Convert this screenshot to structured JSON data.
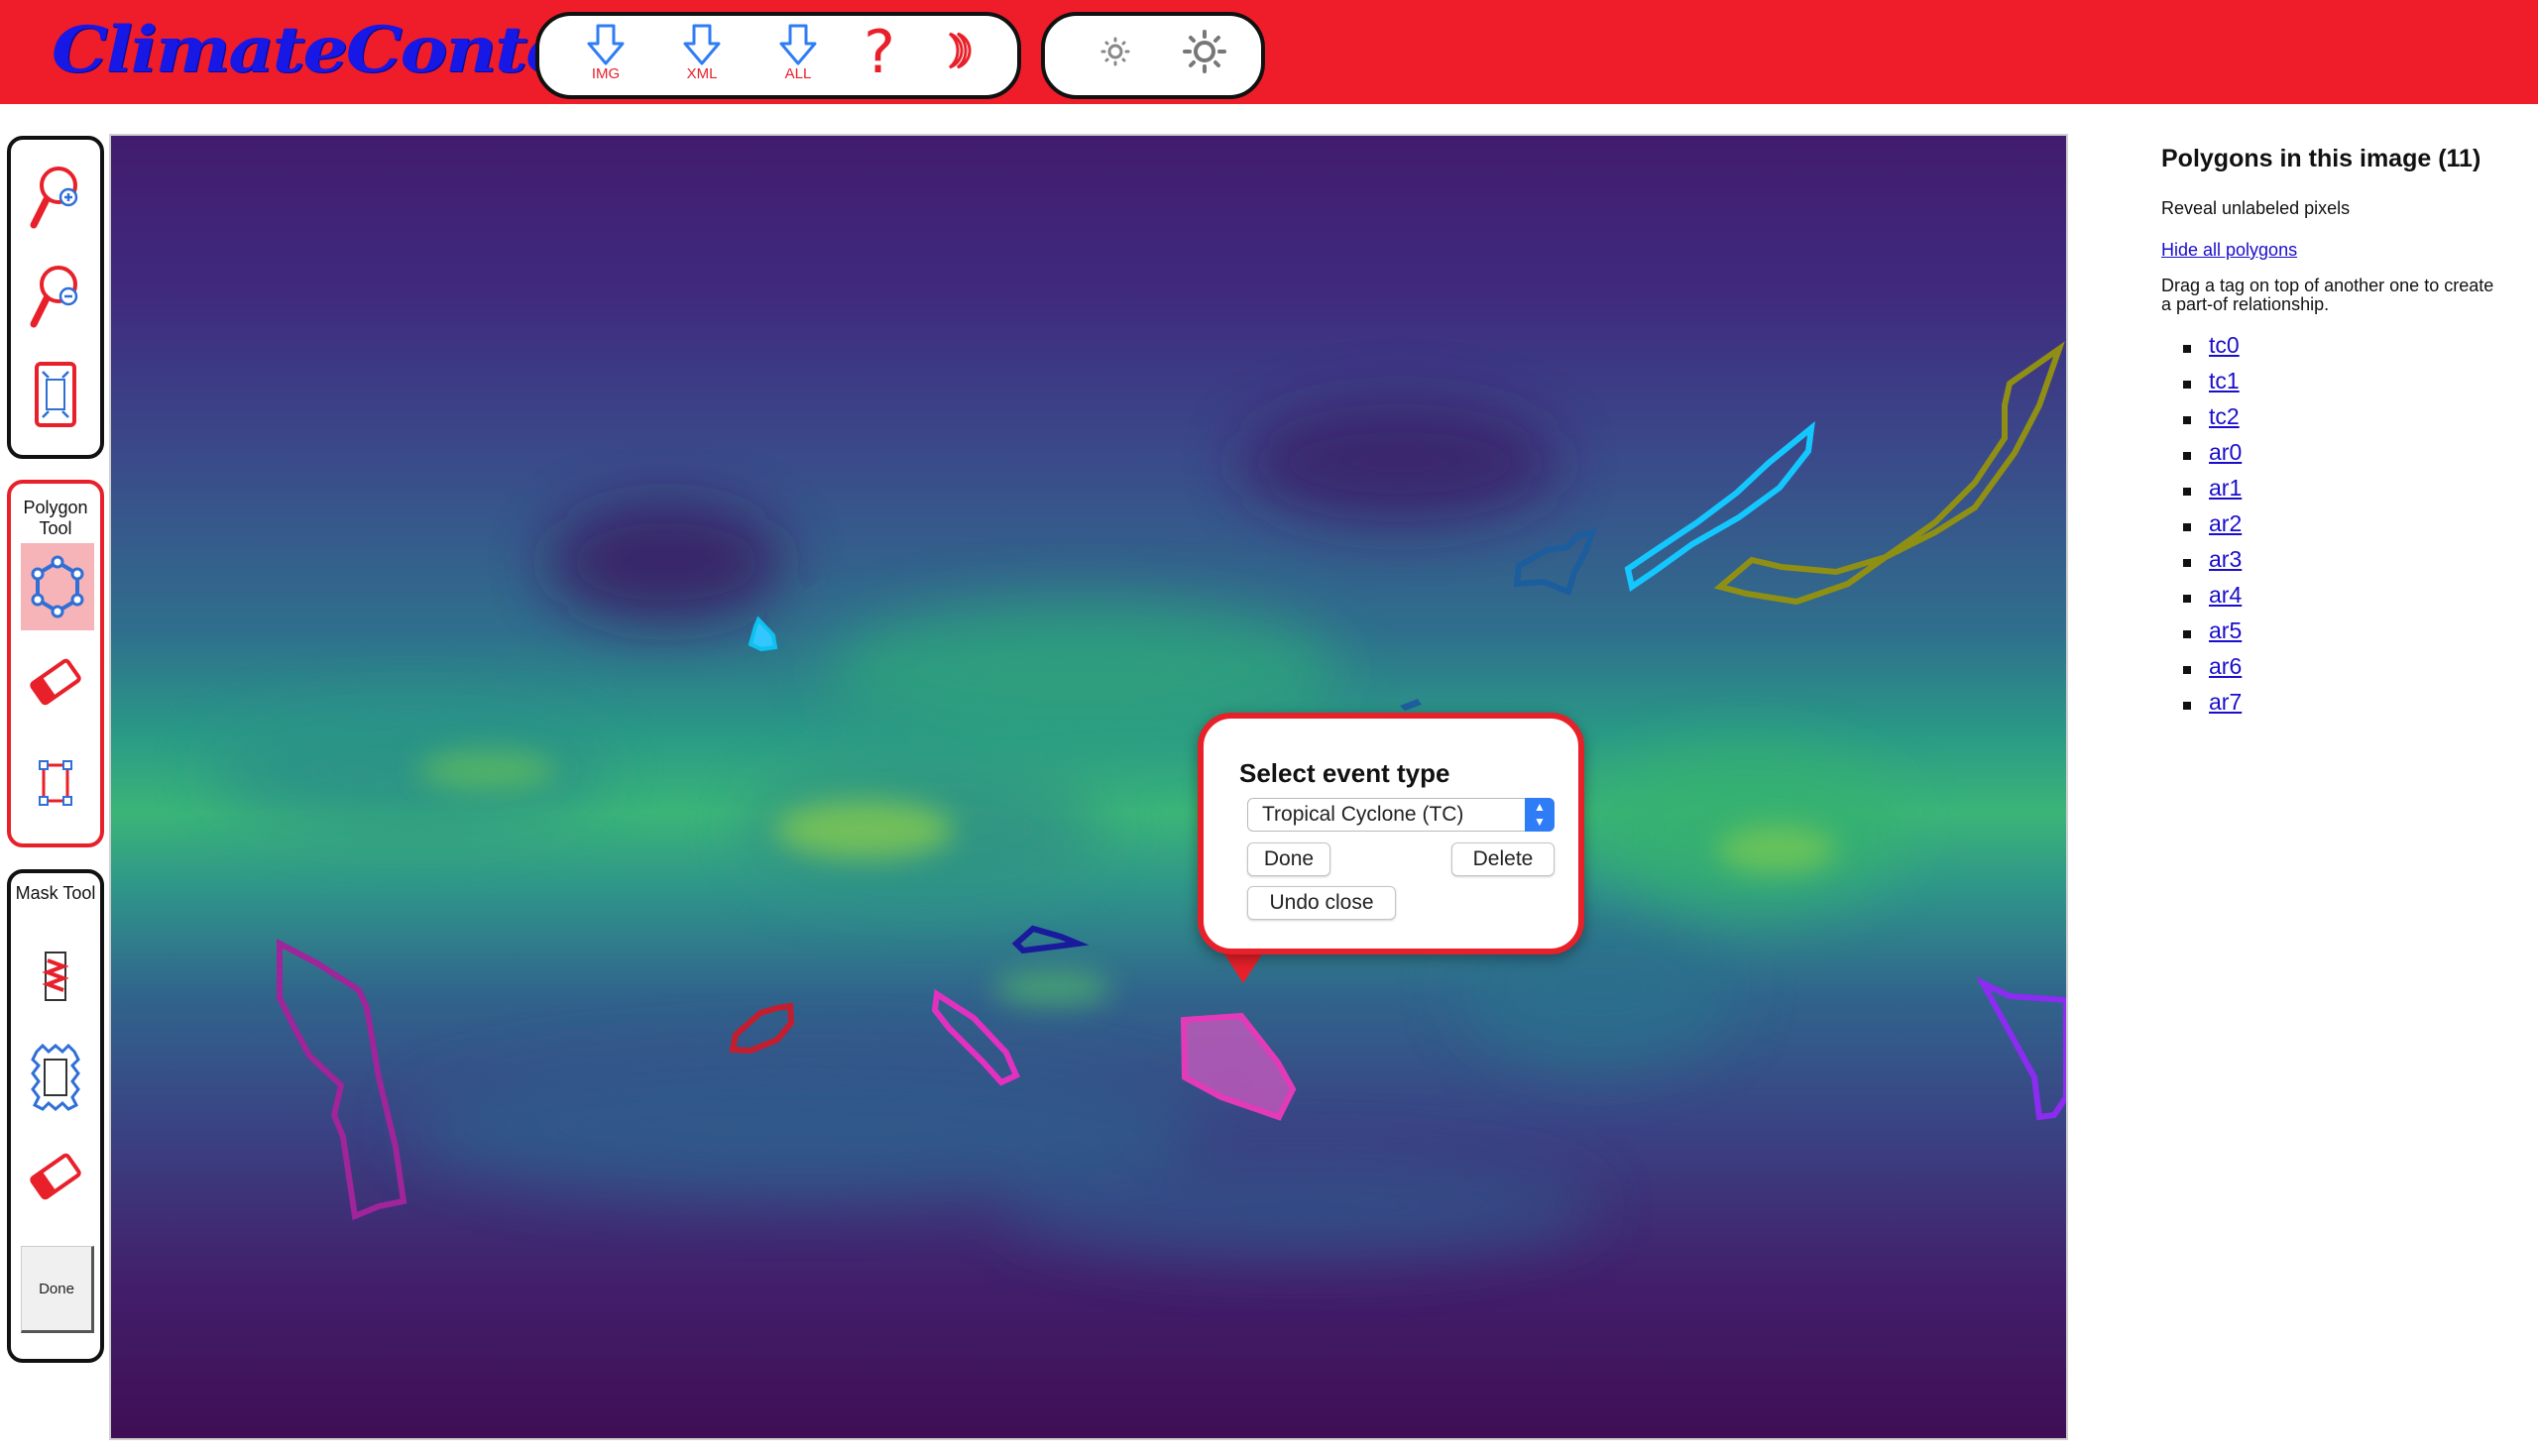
{
  "app": {
    "logo_text": "ClimateContours",
    "brand_color": "#ef1c2a",
    "logo_color": "#1717e6"
  },
  "header": {
    "download_buttons": [
      {
        "label": "IMG",
        "icon": "download-arrow-icon"
      },
      {
        "label": "XML",
        "icon": "download-arrow-icon"
      },
      {
        "label": "ALL",
        "icon": "download-arrow-icon"
      }
    ],
    "help_label": "?",
    "icons": [
      "question-mark-icon",
      "moon-icon",
      "brightness-low-icon",
      "brightness-high-icon"
    ]
  },
  "toolbox": {
    "zoom_tools": [
      "zoom-in-icon",
      "zoom-out-icon",
      "fit-screen-icon"
    ],
    "polygon_title": "Polygon Tool",
    "polygon_tools": [
      "polygon-draw-icon",
      "eraser-icon",
      "bounding-box-icon"
    ],
    "mask_title": "Mask Tool",
    "mask_tools": [
      "brush-icon",
      "mask-region-icon",
      "mask-eraser-icon"
    ],
    "mask_done_label": "Done"
  },
  "popup": {
    "title": "Select event type",
    "selected_event": "Tropical Cyclone (TC)",
    "done_label": "Done",
    "delete_label": "Delete",
    "undo_label": "Undo close"
  },
  "panel": {
    "title": "Polygons in this image (11)",
    "reveal_text": "Reveal unlabeled pixels",
    "hide_all_label": "Hide all polygons",
    "instructions": "Drag a tag on top of another one to create a part-of relationship.",
    "polygons": [
      "tc0",
      "tc1",
      "tc2",
      "ar0",
      "ar1",
      "ar2",
      "ar3",
      "ar4",
      "ar5",
      "ar6",
      "ar7"
    ]
  }
}
